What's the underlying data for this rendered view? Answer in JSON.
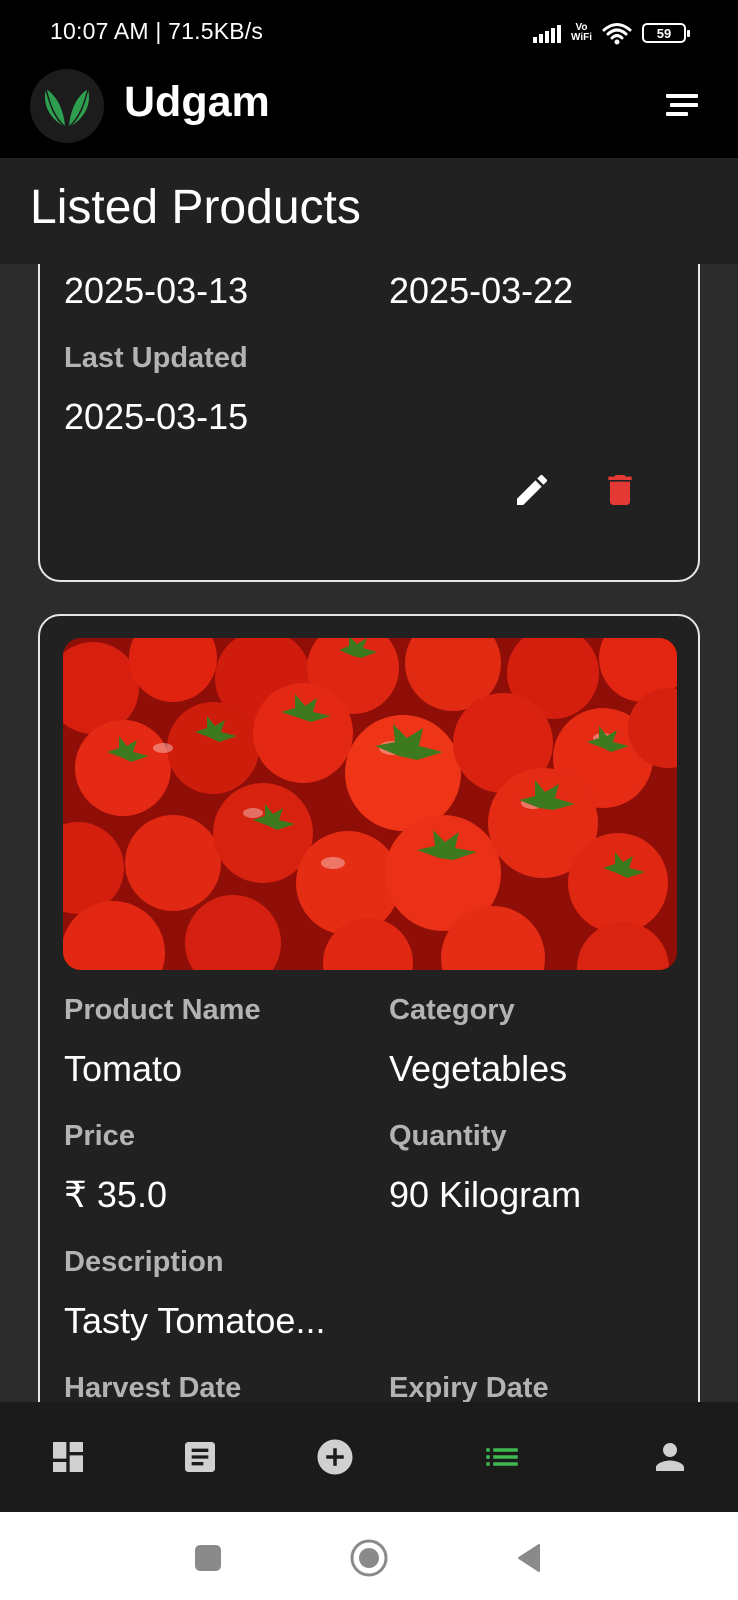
{
  "status_bar": {
    "time_speed": "10:07 AM | 71.5KB/s",
    "vowifi_top": "Vo",
    "vowifi_bottom": "WiFi",
    "battery": "59"
  },
  "app_bar": {
    "title": "Udgam",
    "logo_icon": "leaf-logo-icon",
    "menu_icon": "sort-menu-icon"
  },
  "page": {
    "title": "Listed Products"
  },
  "cards": [
    {
      "harvest_date": "2025-03-13",
      "expiry_date": "2025-03-22",
      "last_updated_label": "Last Updated",
      "last_updated": "2025-03-15",
      "edit_icon": "pencil-icon",
      "delete_icon": "trash-icon"
    },
    {
      "image": "tomatoes-photo",
      "product_name_label": "Product Name",
      "product_name": "Tomato",
      "category_label": "Category",
      "category": "Vegetables",
      "price_label": "Price",
      "price": "₹ 35.0",
      "quantity_label": "Quantity",
      "quantity": "90 Kilogram",
      "description_label": "Description",
      "description": "Tasty Tomatoe...",
      "harvest_date_label": "Harvest Date",
      "expiry_date_label": "Expiry Date"
    }
  ],
  "bottom_nav": {
    "items": [
      {
        "icon": "dashboard-icon",
        "active": false
      },
      {
        "icon": "article-icon",
        "active": false
      },
      {
        "icon": "add-circle-icon",
        "active": false
      },
      {
        "icon": "list-icon",
        "active": true
      },
      {
        "icon": "person-icon",
        "active": false
      }
    ],
    "active_color": "#3fb950",
    "inactive_color": "#d0d0d0"
  },
  "system_nav": {
    "items": [
      "recents-square-icon",
      "home-circle-icon",
      "back-triangle-icon"
    ]
  },
  "colors": {
    "background": "#2c2c2c",
    "card": "#212121",
    "delete": "#e53935"
  }
}
